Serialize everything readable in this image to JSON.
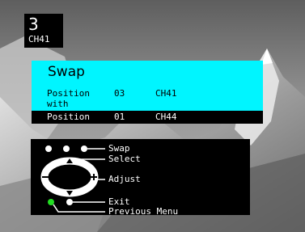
{
  "channel": {
    "number": "3",
    "name": "CH41"
  },
  "swap": {
    "title": "Swap",
    "position_label": "Position",
    "with_label": "with",
    "from": {
      "position": "03",
      "channel": "CH41"
    },
    "to": {
      "position": "01",
      "channel": "CH44"
    }
  },
  "help": {
    "swap": "Swap",
    "select": "Select",
    "adjust": "Adjust",
    "exit": "Exit",
    "previous_menu": "Previous Menu"
  },
  "colors": {
    "panel": "#00f5ff",
    "osd_bg": "#000000",
    "exit_dot": "#22dd22"
  }
}
